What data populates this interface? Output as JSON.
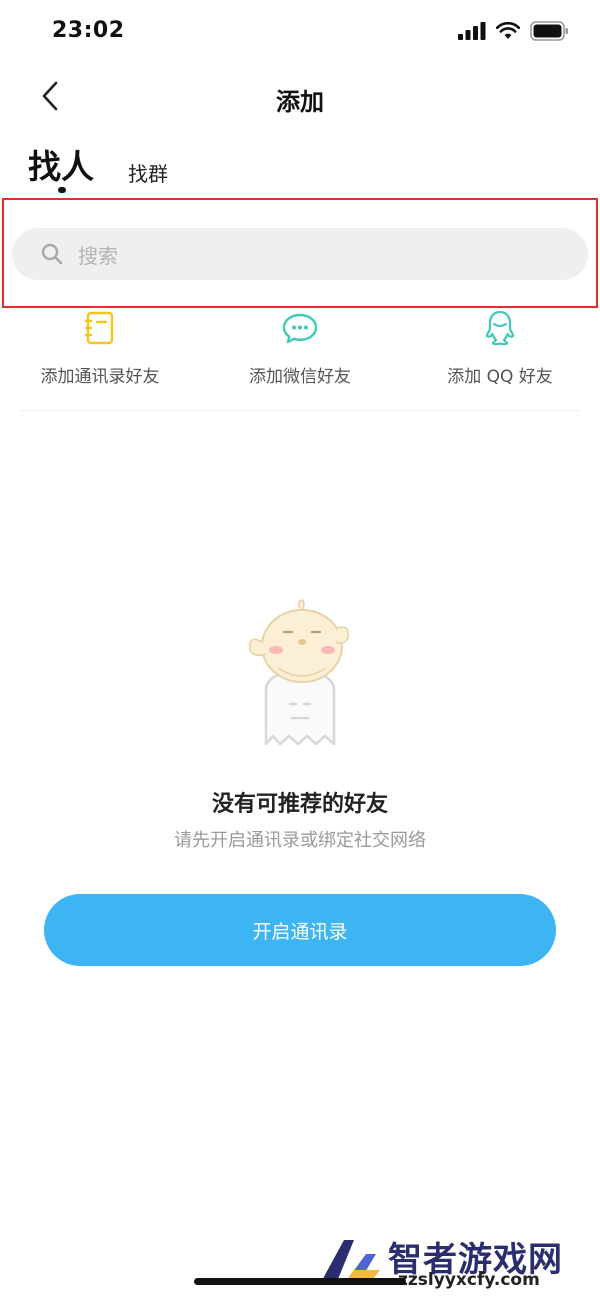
{
  "status_bar": {
    "time": "23:02"
  },
  "nav": {
    "title": "添加"
  },
  "tabs": {
    "active": "找人",
    "inactive": "找群"
  },
  "search": {
    "placeholder": "搜索"
  },
  "quick_actions": [
    {
      "label": "添加通讯录好友",
      "icon": "contacts-book-icon",
      "color": "#f5c518"
    },
    {
      "label": "添加微信好友",
      "icon": "wechat-icon",
      "color": "#3ec9b9"
    },
    {
      "label": "添加 QQ 好友",
      "icon": "qq-icon",
      "color": "#3ec9b9"
    }
  ],
  "empty_state": {
    "title": "没有可推荐的好友",
    "subtitle": "请先开启通讯录或绑定社交网络"
  },
  "primary_button": {
    "label": "开启通讯录",
    "color": "#3db5f3"
  },
  "highlight_color": "#e03030",
  "watermark": {
    "title": "智者游戏网",
    "url": "zzslyyxcfy.com"
  }
}
